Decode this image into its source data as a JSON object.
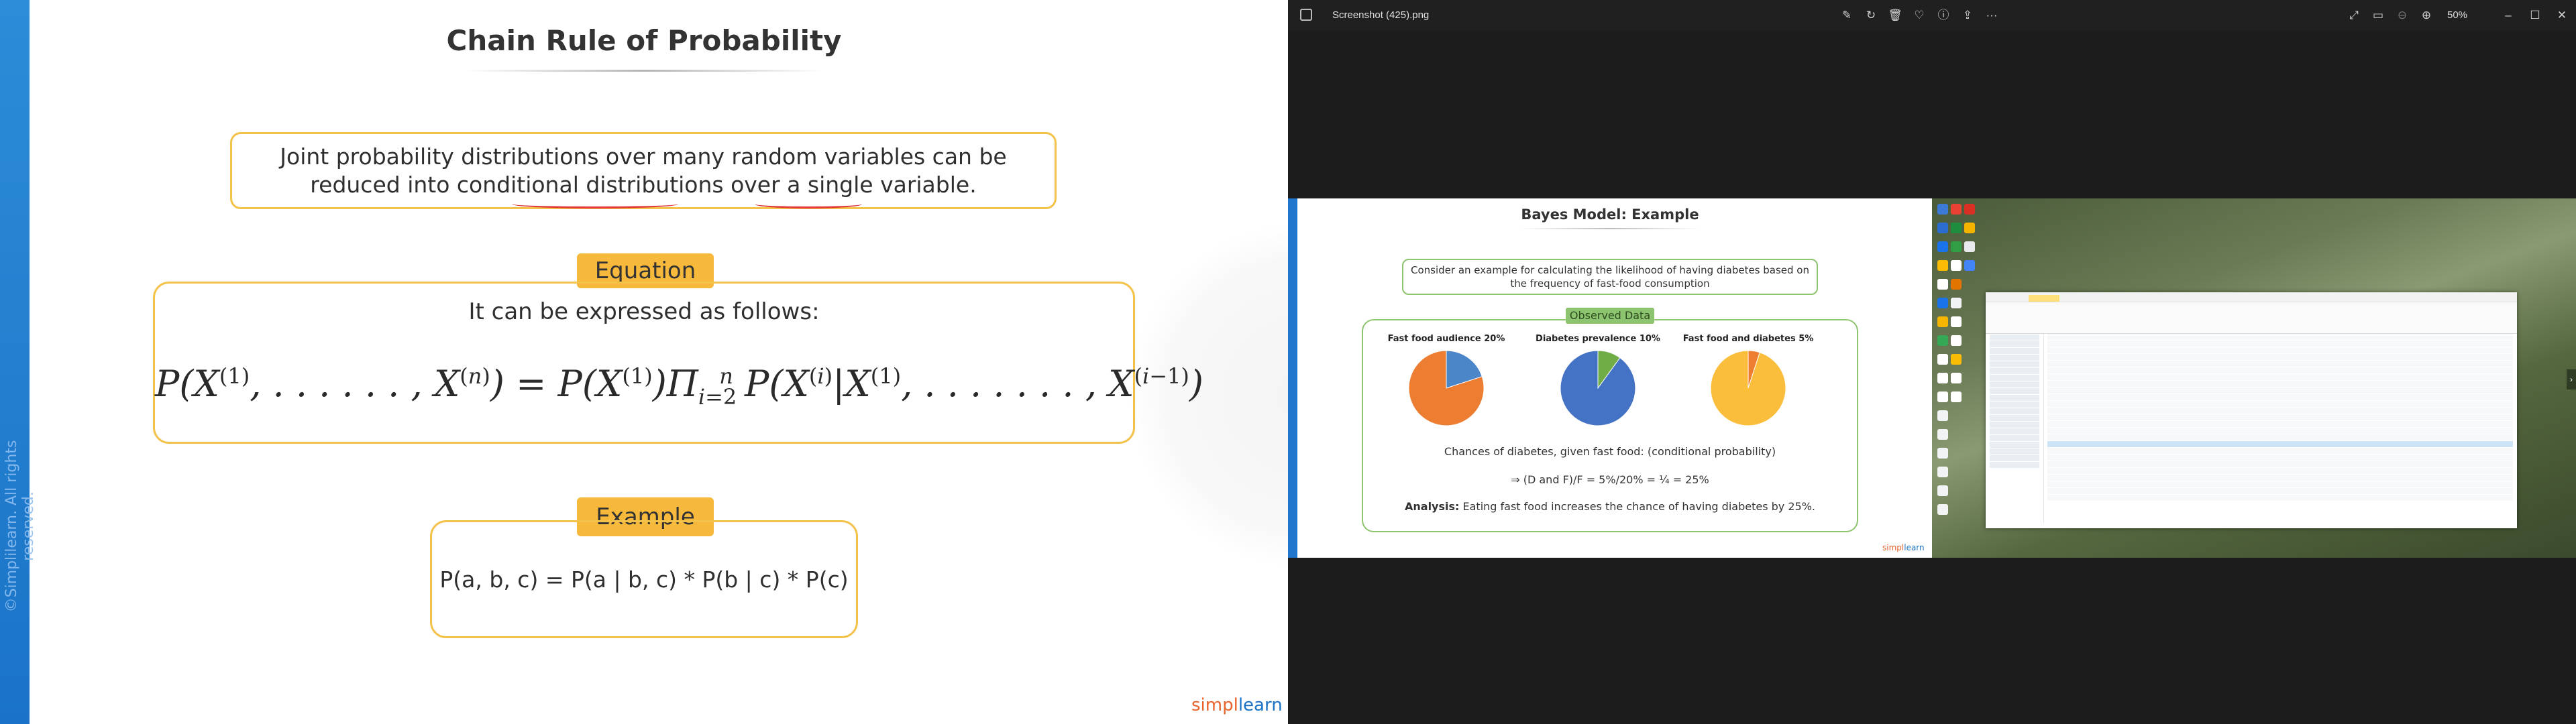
{
  "left_slide": {
    "title": "Chain Rule of Probability",
    "intro": "Joint probability distributions over many random variables can be reduced into conditional distributions over a single variable.",
    "equation_label": "Equation",
    "equation_intro": "It can be expressed as follows:",
    "example_label": "Example",
    "example_text": "P(a, b, c) = P(a | b, c) * P(b | c) * P(c)",
    "copyright": "©Simplilearn. All rights reserved.",
    "logo_a": "simpl",
    "logo_b": "learn"
  },
  "viewer": {
    "file_title": "Screenshot (425).png",
    "zoom": "50%",
    "toolbar_icons": [
      "edit-image-icon",
      "rotate-icon",
      "delete-icon",
      "favorite-icon",
      "info-icon",
      "share-icon",
      "more-icon"
    ],
    "right_icons": [
      "fullscreen-icon",
      "slideshow-icon",
      "zoom-out-icon",
      "zoom-in-icon"
    ],
    "window_controls": [
      "minimize-icon",
      "maximize-icon",
      "close-icon"
    ]
  },
  "right_slide": {
    "title": "Bayes Model: Example",
    "intro": "Consider an example for calculating the likelihood of having diabetes based on the frequency of fast-food consumption",
    "observed_label": "Observed Data",
    "chances": "Chances of diabetes, given fast food: (conditional probability)",
    "calc": "⇒ (D and F)/F = 5%/20% = ¼ = 25%",
    "analysis_label": "Analysis:",
    "analysis": " Eating fast food increases the chance of having diabetes by 25%.",
    "logo_a": "simpl",
    "logo_b": "learn"
  },
  "chart_data": [
    {
      "type": "pie",
      "title": "Fast food audience 20%",
      "values": [
        20,
        80
      ],
      "colors": [
        "#4a86c8",
        "#ed7d31"
      ]
    },
    {
      "type": "pie",
      "title": "Diabetes prevalence 10%",
      "values": [
        10,
        90
      ],
      "colors": [
        "#70ad47",
        "#4472c4"
      ]
    },
    {
      "type": "pie",
      "title": "Fast food and diabetes 5%",
      "values": [
        5,
        95
      ],
      "colors": [
        "#ed7d31",
        "#fbbd3c"
      ]
    }
  ]
}
